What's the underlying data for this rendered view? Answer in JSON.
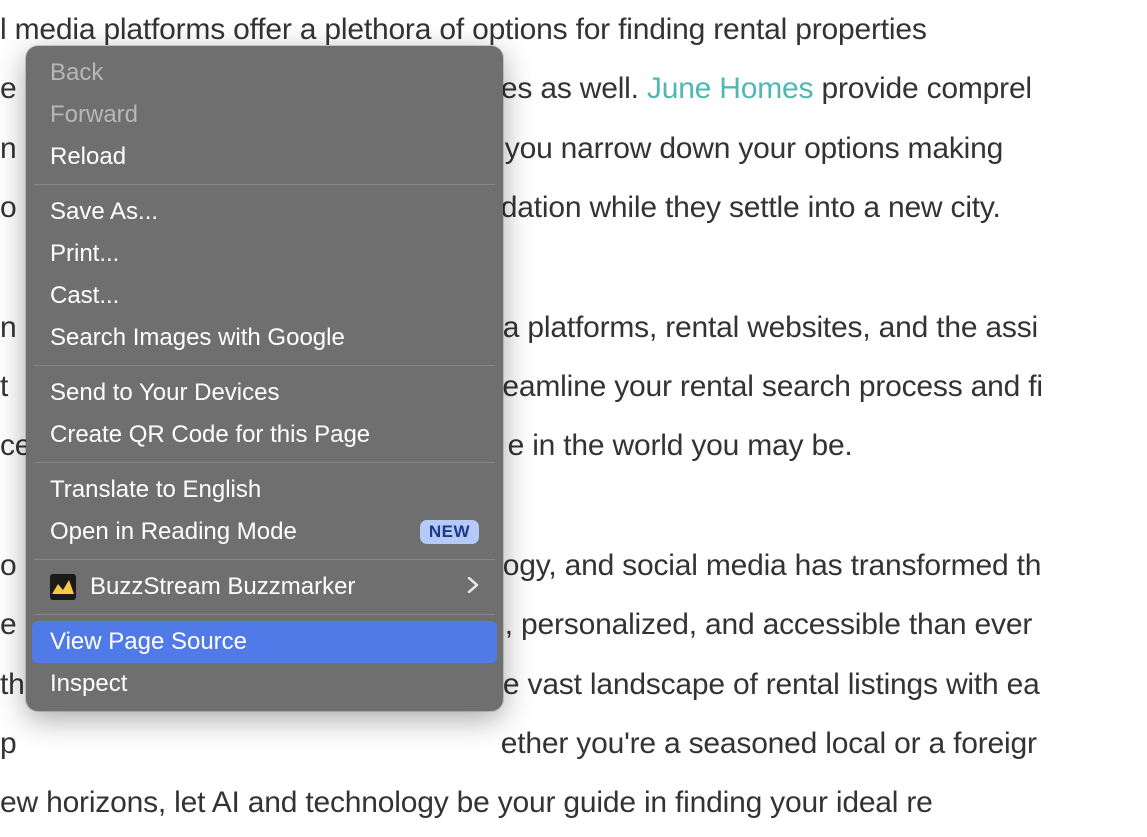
{
  "article": {
    "line1_a": "l media platforms offer a plethora of options for finding rental properties",
    "line2_a": "e",
    "line2_b": "tes as well. ",
    "line2_link": "June Homes",
    "line2_c": " provide comprel",
    "line3_a": "n",
    "line3_b": "you narrow down your options making",
    "line4_a": "o",
    "line4_b": "dation while they settle into a new city.",
    "line6_a": "n",
    "line6_b": "a platforms, rental websites, and the assi",
    "line7_a": "t",
    "line7_b": "eamline your rental search process and fi",
    "line8_a": "ce",
    "line8_b": "e in the world you may be.",
    "line10_a": "o",
    "line10_b": "ogy, and social media has transformed th",
    "line11_a": "e",
    "line11_b": ", personalized, and accessible than ever",
    "line12_a": "th",
    "line12_b": "e vast landscape of rental listings with ea",
    "line13_a": "p",
    "line13_b": "ether you're a seasoned local or a foreigr",
    "line14": "ew horizons, let AI and technology be your guide in finding your ideal re"
  },
  "menu": {
    "back": "Back",
    "forward": "Forward",
    "reload": "Reload",
    "save_as": "Save As...",
    "print": "Print...",
    "cast": "Cast...",
    "search_images": "Search Images with Google",
    "send_to_devices": "Send to Your Devices",
    "create_qr": "Create QR Code for this Page",
    "translate": "Translate to English",
    "reading_mode": "Open in Reading Mode",
    "reading_mode_badge": "NEW",
    "buzzstream": "BuzzStream Buzzmarker",
    "view_source": "View Page Source",
    "inspect": "Inspect"
  }
}
